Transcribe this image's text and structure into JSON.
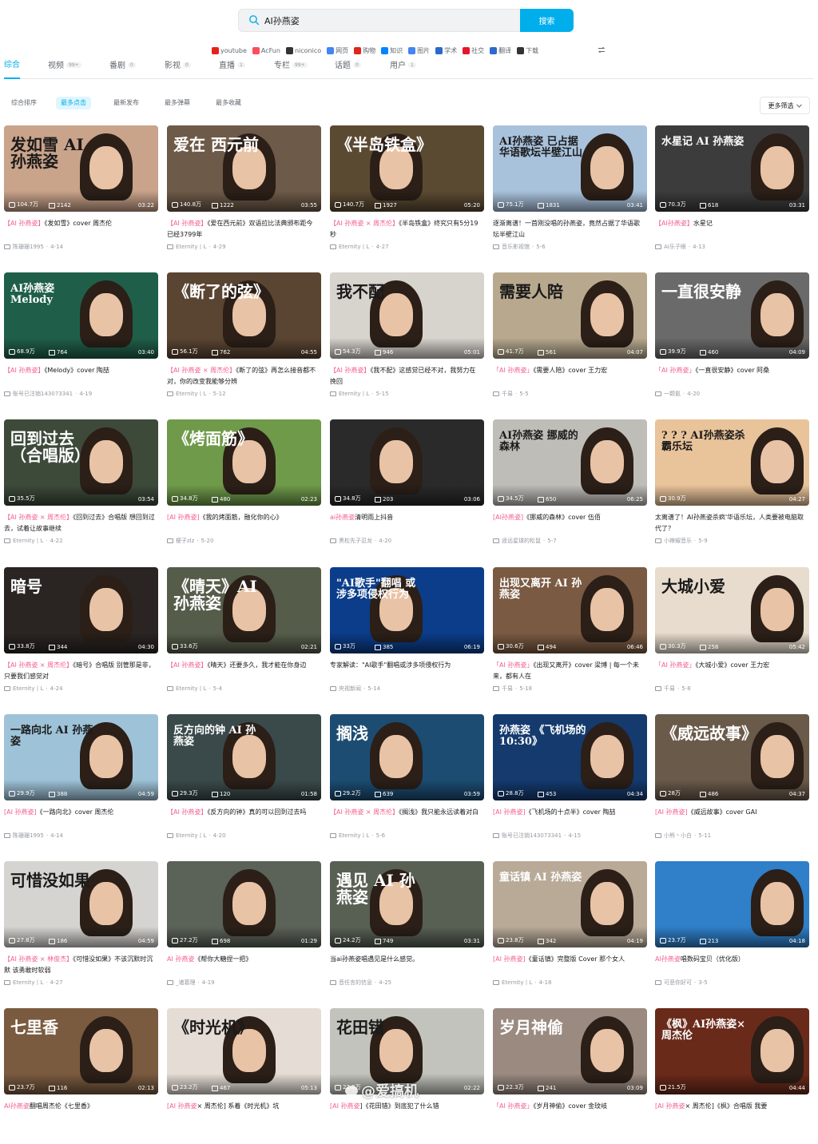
{
  "search": {
    "value": "AI孙燕姿",
    "button_label": "搜索"
  },
  "external_sites": [
    {
      "label": "youtube",
      "color": "#e62117",
      "icon": "youtube-icon"
    },
    {
      "label": "AcFun",
      "color": "#fd4c5b",
      "icon": "acfun-icon"
    },
    {
      "label": "niconico",
      "color": "#333333",
      "icon": "niconico-icon"
    },
    {
      "label": "网页",
      "color": "#4285f4",
      "icon": "google-icon"
    },
    {
      "label": "购物",
      "color": "#e1251b",
      "icon": "jd-icon"
    },
    {
      "label": "知识",
      "color": "#0084ff",
      "icon": "zhihu-icon"
    },
    {
      "label": "图片",
      "color": "#4285f4",
      "icon": "google-icon"
    },
    {
      "label": "学术",
      "color": "#2b6acb",
      "icon": "xueshu-icon"
    },
    {
      "label": "社交",
      "color": "#e6162d",
      "icon": "weibo-icon"
    },
    {
      "label": "翻译",
      "color": "#2b6acb",
      "icon": "translate-icon"
    },
    {
      "label": "下载",
      "color": "#333333",
      "icon": "download-icon"
    }
  ],
  "tabs": [
    {
      "label": "综合",
      "count": ""
    },
    {
      "label": "视频",
      "count": "99+"
    },
    {
      "label": "番剧",
      "count": "0"
    },
    {
      "label": "影视",
      "count": "0"
    },
    {
      "label": "直播",
      "count": "1"
    },
    {
      "label": "专栏",
      "count": "99+"
    },
    {
      "label": "话题",
      "count": "0"
    },
    {
      "label": "用户",
      "count": "1"
    }
  ],
  "sort_options": [
    "综合排序",
    "最多点击",
    "最新发布",
    "最多弹幕",
    "最多收藏"
  ],
  "more_filter": "更多筛选",
  "watermark": "@爱搞机",
  "accent": "#00aeec",
  "highlight": "#f25d8e",
  "videos": [
    {
      "play": "104.7万",
      "danmaku": "2142",
      "duration": "03:22",
      "title_hl": "【AI 孙燕姿】",
      "title_rest": "《发如雪》cover 周杰伦",
      "author": "陈珊珊1995",
      "date": "4-14",
      "overlay": "发如雪  AI孙燕姿",
      "bg": "#c9a38a"
    },
    {
      "play": "140.8万",
      "danmaku": "1222",
      "duration": "03:55",
      "title_hl": "【AI 孙燕姿】",
      "title_rest": "《爱在西元前》双语拉比法典颁布距今已经3799年",
      "author": "Eternity丨L",
      "date": "4-29",
      "overlay": "爱在  西元前",
      "bg": "#6e5a48"
    },
    {
      "play": "140.7万",
      "danmaku": "1927",
      "duration": "05:20",
      "title_hl": "【AI 孙燕姿 × 周杰伦】",
      "title_rest": "《半岛铁盒》终究只有5分19秒",
      "author": "Eternity丨L",
      "date": "4-27",
      "overlay": "《半岛铁盒》",
      "bg": "#5b4a32"
    },
    {
      "play": "75.1万",
      "danmaku": "1831",
      "duration": "03:41",
      "title_hl": "",
      "title_rest": "逐渐离谱！一首刚没唱的孙燕姿，竟然占据了华语歌坛半壁江山",
      "author": "音乐影视馆",
      "date": "5-6",
      "overlay": "AI孙燕姿  已占据华语歌坛半壁江山",
      "bg": "#a9c2dc"
    },
    {
      "play": "70.3万",
      "danmaku": "618",
      "duration": "03:31",
      "title_hl": "【AI孙燕姿】",
      "title_rest": "水星记",
      "author": "AI乐子眼",
      "date": "4-13",
      "overlay": "水星记  AI 孙燕姿",
      "bg": "#3c3c3c"
    },
    {
      "play": "68.9万",
      "danmaku": "764",
      "duration": "03:40",
      "title_hl": "【AI 孙燕姿】",
      "title_rest": "《Melody》cover 陶喆",
      "author": "账号已注销143073341",
      "date": "4-19",
      "overlay": "AI孙燕姿  Melody",
      "bg": "#1f5f4a"
    },
    {
      "play": "56.1万",
      "danmaku": "762",
      "duration": "04:55",
      "title_hl": "【AI 孙燕姿 × 周杰伦】",
      "title_rest": "《断了的弦》再怎么接音都不对，你的改变我能够分辨",
      "author": "Eternity丨L",
      "date": "5-12",
      "overlay": "《断了的弦》",
      "bg": "#5a4432"
    },
    {
      "play": "54.3万",
      "danmaku": "946",
      "duration": "05:01",
      "title_hl": "【AI 孙燕姿】",
      "title_rest": "《我不配》这感觉已经不对，我努力在挽回",
      "author": "Eternity丨L",
      "date": "5-15",
      "overlay": "我不配",
      "bg": "#d7d3cd"
    },
    {
      "play": "41.7万",
      "danmaku": "561",
      "duration": "04:07",
      "title_hl": "「AI 孙燕姿」",
      "title_rest": "《需要人陪》cover 王力宏",
      "author": "千易",
      "date": "5-5",
      "overlay": "需要人陪",
      "bg": "#b8a98e"
    },
    {
      "play": "39.9万",
      "danmaku": "460",
      "duration": "04:09",
      "title_hl": "「AI 孙燕姿」",
      "title_rest": "《一直很安静》cover 阿桑",
      "author": "一颗氦",
      "date": "4-20",
      "overlay": "一直很安静",
      "bg": "#6a6a6a"
    },
    {
      "play": "35.5万",
      "danmaku": "",
      "duration": "03:54",
      "title_hl": "【AI 孙燕姿 × 周杰伦】",
      "title_rest": "《回到过去》合唱版 想回到过去，试着让故事继续",
      "author": "Eternity丨L",
      "date": "4-22",
      "overlay": "回到过去（合唱版）",
      "bg": "#3d4a3a"
    },
    {
      "play": "34.8万",
      "danmaku": "480",
      "duration": "02:23",
      "title_hl": "[AI 孙燕姿]",
      "title_rest": "《我的烤面筋，融化你的心》",
      "author": "梗子zlz",
      "date": "5-20",
      "overlay": "《烤面筋》",
      "bg": "#6f9a4a"
    },
    {
      "play": "34.8万",
      "danmaku": "203",
      "duration": "03:06",
      "title_hl": "ai孙燕姿",
      "title_rest": "清明雨上抖音",
      "author": "黑松先子忍龙",
      "date": "4-20",
      "overlay": "",
      "bg": "#2a2a2a"
    },
    {
      "play": "34.5万",
      "danmaku": "650",
      "duration": "06:25",
      "title_hl": "[AI孙燕姿]",
      "title_rest": "《挪威的森林》cover 伍佰",
      "author": "遥远星球的松鼠",
      "date": "5-7",
      "overlay": "AI孙燕姿  挪威的森林",
      "bg": "#bfbdb8"
    },
    {
      "play": "30.9万",
      "danmaku": "",
      "duration": "04:27",
      "title_hl": "",
      "title_rest": "太离谱了！AI孙燕姿杀疯'华语乐坛，人类要被电脑取代了？",
      "author": "小辣椒音乐",
      "date": "5-9",
      "overlay": "? ? ?  AI孙燕姿杀霸乐坛",
      "bg": "#e9c39a"
    },
    {
      "play": "33.8万",
      "danmaku": "344",
      "duration": "04:30",
      "title_hl": "【AI 孙燕姿 × 周杰伦】",
      "title_rest": "《暗号》合唱版 别管那是非，只要我们感觉对",
      "author": "Eternity丨L",
      "date": "4-24",
      "overlay": "暗号",
      "bg": "#2a2523"
    },
    {
      "play": "33.6万",
      "danmaku": "",
      "duration": "02:21",
      "title_hl": "【AI 孙燕姿】",
      "title_rest": "《晴天》还要多久，我才能在你身边",
      "author": "Eternity丨L",
      "date": "5-4",
      "overlay": "《晴天》AI 孙燕姿",
      "bg": "#555c4a"
    },
    {
      "play": "33万",
      "danmaku": "385",
      "duration": "06:19",
      "title_hl": "",
      "title_rest": "专家解读：\"AI歌手\"翻唱或涉多项侵权行为",
      "author": "央视新闻",
      "date": "5-14",
      "overlay": "\"AI歌手\"翻唱  或涉多项侵权行为",
      "bg": "#0b3d8a"
    },
    {
      "play": "30.6万",
      "danmaku": "494",
      "duration": "06:46",
      "title_hl": "「AI 孙燕姿」",
      "title_rest": "《出现又离开》cover 梁博 | 每一个未来，都有人在",
      "author": "千易",
      "date": "5-18",
      "overlay": "出现又离开  AI 孙燕姿",
      "bg": "#7a5a42"
    },
    {
      "play": "30.3万",
      "danmaku": "258",
      "duration": "05:42",
      "title_hl": "「AI 孙燕姿」",
      "title_rest": "《大城小爱》cover 王力宏",
      "author": "千易",
      "date": "5-8",
      "overlay": "大城小爱",
      "bg": "#e7dccd"
    },
    {
      "play": "29.9万",
      "danmaku": "388",
      "duration": "04:59",
      "title_hl": "[AI 孙燕姿]",
      "title_rest": "《一路向北》cover 周杰伦",
      "author": "陈珊珊1995",
      "date": "4-14",
      "overlay": "一路向北  AI 孙燕姿",
      "bg": "#9ec3d8"
    },
    {
      "play": "29.3万",
      "danmaku": "120",
      "duration": "01:58",
      "title_hl": "【AI 孙燕姿】",
      "title_rest": "《反方向的钟》真的可以回到过去吗",
      "author": "Eternity丨L",
      "date": "4-20",
      "overlay": "反方向的钟  AI 孙燕姿",
      "bg": "#3a4a4a"
    },
    {
      "play": "29.2万",
      "danmaku": "639",
      "duration": "03:59",
      "title_hl": "【AI 孙燕姿 × 周杰伦】",
      "title_rest": "《搁浅》我只能永远读着对白",
      "author": "Eternity丨L",
      "date": "5-6",
      "overlay": "搁浅",
      "bg": "#1c4c72"
    },
    {
      "play": "28.8万",
      "danmaku": "453",
      "duration": "04:34",
      "title_hl": "[AI 孙燕姿]",
      "title_rest": "《飞机场的十点半》cover 陶喆",
      "author": "账号已注销143073341",
      "date": "4-15",
      "overlay": "孙燕姿  《飞机场的10:30》",
      "bg": "#143a6e"
    },
    {
      "play": "28万",
      "danmaku": "486",
      "duration": "04:37",
      "title_hl": "[AI 孙燕姿]",
      "title_rest": "《威远故事》cover GAI",
      "author": "小熊丶小白",
      "date": "5-11",
      "overlay": "《威远故事》",
      "bg": "#6a5a4a"
    },
    {
      "play": "27.8万",
      "danmaku": "186",
      "duration": "04:59",
      "title_hl": "【AI 孙燕姿 × 林俊杰】",
      "title_rest": "《可惜没如果》不该沉默时沉默 该勇敢时软弱",
      "author": "Eternity丨L",
      "date": "4-27",
      "overlay": "可惜没如果",
      "bg": "#d6d4d0"
    },
    {
      "play": "27.2万",
      "danmaku": "698",
      "duration": "01:29",
      "title_hl": "AI 孙燕姿",
      "title_rest": "《帮你大糖捏一把》",
      "author": "_诸葛理",
      "date": "4-19",
      "overlay": "",
      "bg": "#5b6258"
    },
    {
      "play": "24.2万",
      "danmaku": "749",
      "duration": "03:31",
      "title_hl": "",
      "title_rest": "当ai孙燕姿唱遇见是什么感觉。",
      "author": "音任言的信息",
      "date": "4-25",
      "overlay": "遇见  AI 孙燕姿",
      "bg": "#586054"
    },
    {
      "play": "23.8万",
      "danmaku": "342",
      "duration": "04:19",
      "title_hl": "[AI 孙燕姿]",
      "title_rest": "《童话镇》完整版 Cover 那个女人",
      "author": "Eternity丨L",
      "date": "4-18",
      "overlay": "童话镇  AI 孙燕姿",
      "bg": "#b9aa98"
    },
    {
      "play": "23.7万",
      "danmaku": "213",
      "duration": "04:18",
      "title_hl": "AI孙燕姿",
      "title_rest": "唱数码宝贝（优化版）",
      "author": "可恶你好可",
      "date": "3-5",
      "overlay": "",
      "bg": "#2f7fc9"
    },
    {
      "play": "23.7万",
      "danmaku": "116",
      "duration": "02:13",
      "title_hl": "AI孙燕姿",
      "title_rest": "翻唱周杰伦《七里香》",
      "author": "",
      "date": "",
      "overlay": "七里香",
      "bg": "#7a5b3f"
    },
    {
      "play": "23.2万",
      "danmaku": "467",
      "duration": "05:13",
      "title_hl": "[AI 孙燕姿",
      "title_rest": "× 周杰伦] 系着《时光机》坑",
      "author": "",
      "date": "",
      "overlay": "《时光机》",
      "bg": "#e5ddd5"
    },
    {
      "play": "22.9万",
      "danmaku": "",
      "duration": "02:22",
      "title_hl": "[AI 孙燕姿",
      "title_rest": "]《花田错》到底犯了什么错",
      "author": "",
      "date": "",
      "overlay": "花田错",
      "bg": "#c3c3bd"
    },
    {
      "play": "22.3万",
      "danmaku": "241",
      "duration": "03:09",
      "title_hl": "「AI 孙燕姿」",
      "title_rest": "《岁月神偷》cover 金玟岐",
      "author": "",
      "date": "",
      "overlay": "岁月神偷",
      "bg": "#9a8a80"
    },
    {
      "play": "21.5万",
      "danmaku": "",
      "duration": "04:44",
      "title_hl": "[AI 孙燕姿",
      "title_rest": "× 周杰伦]《枫》合唱版 我要",
      "author": "",
      "date": "",
      "overlay": "《枫》AI孙燕姿×周杰伦",
      "bg": "#6a2a1a"
    }
  ]
}
